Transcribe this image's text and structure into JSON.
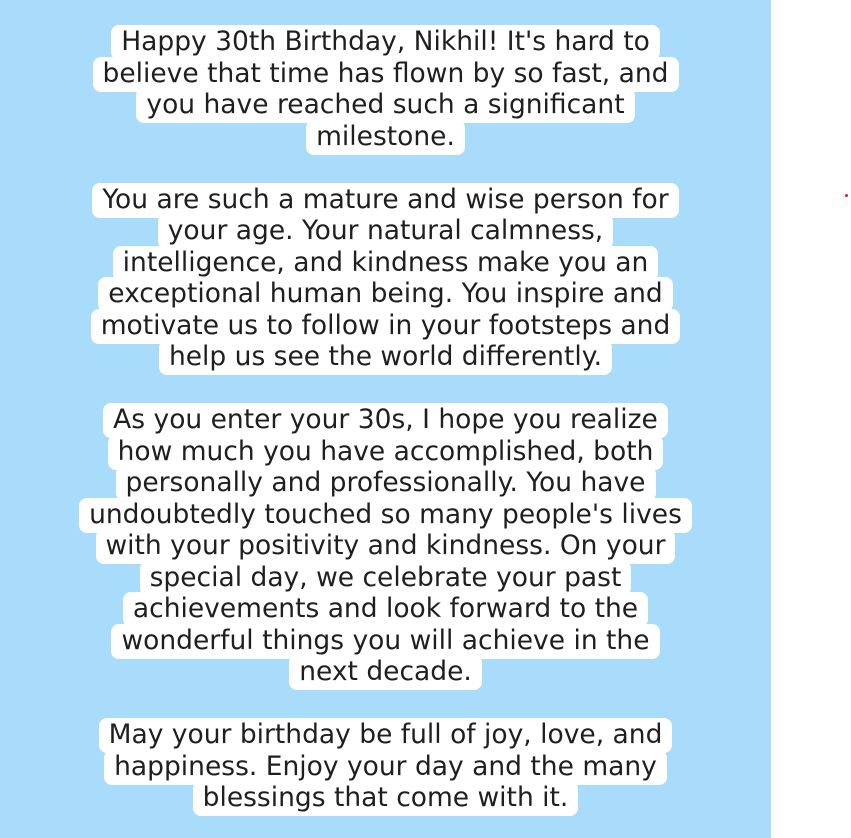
{
  "card": {
    "paragraphs": [
      [
        "Happy 30th Birthday, Nikhil! It's hard to",
        "believe that time has flown by so fast, and",
        "you have reached such a significant",
        "milestone."
      ],
      [
        "You are such a mature and wise person for",
        "your age. Your natural calmness,",
        "intelligence, and kindness make you an",
        "exceptional human being. You inspire and",
        "motivate us to follow in your footsteps and",
        "help us see the world differently."
      ],
      [
        "As you enter your 30s, I hope you realize",
        "how much you have accomplished, both",
        "personally and professionally. You have",
        "undoubtedly touched so many people's lives",
        "with your positivity and kindness. On your",
        "special day, we celebrate your past",
        "achievements and look forward to the",
        "wonderful things you will achieve in the",
        "next decade."
      ],
      [
        "May your birthday be full of joy, love, and",
        "happiness. Enjoy your day and the many",
        "blessings that come with it."
      ]
    ]
  },
  "colors": {
    "panel_background": "#a9dcfa",
    "text_highlight": "#ffffff",
    "text": "#1f1f1f",
    "marker": "#e02020"
  }
}
